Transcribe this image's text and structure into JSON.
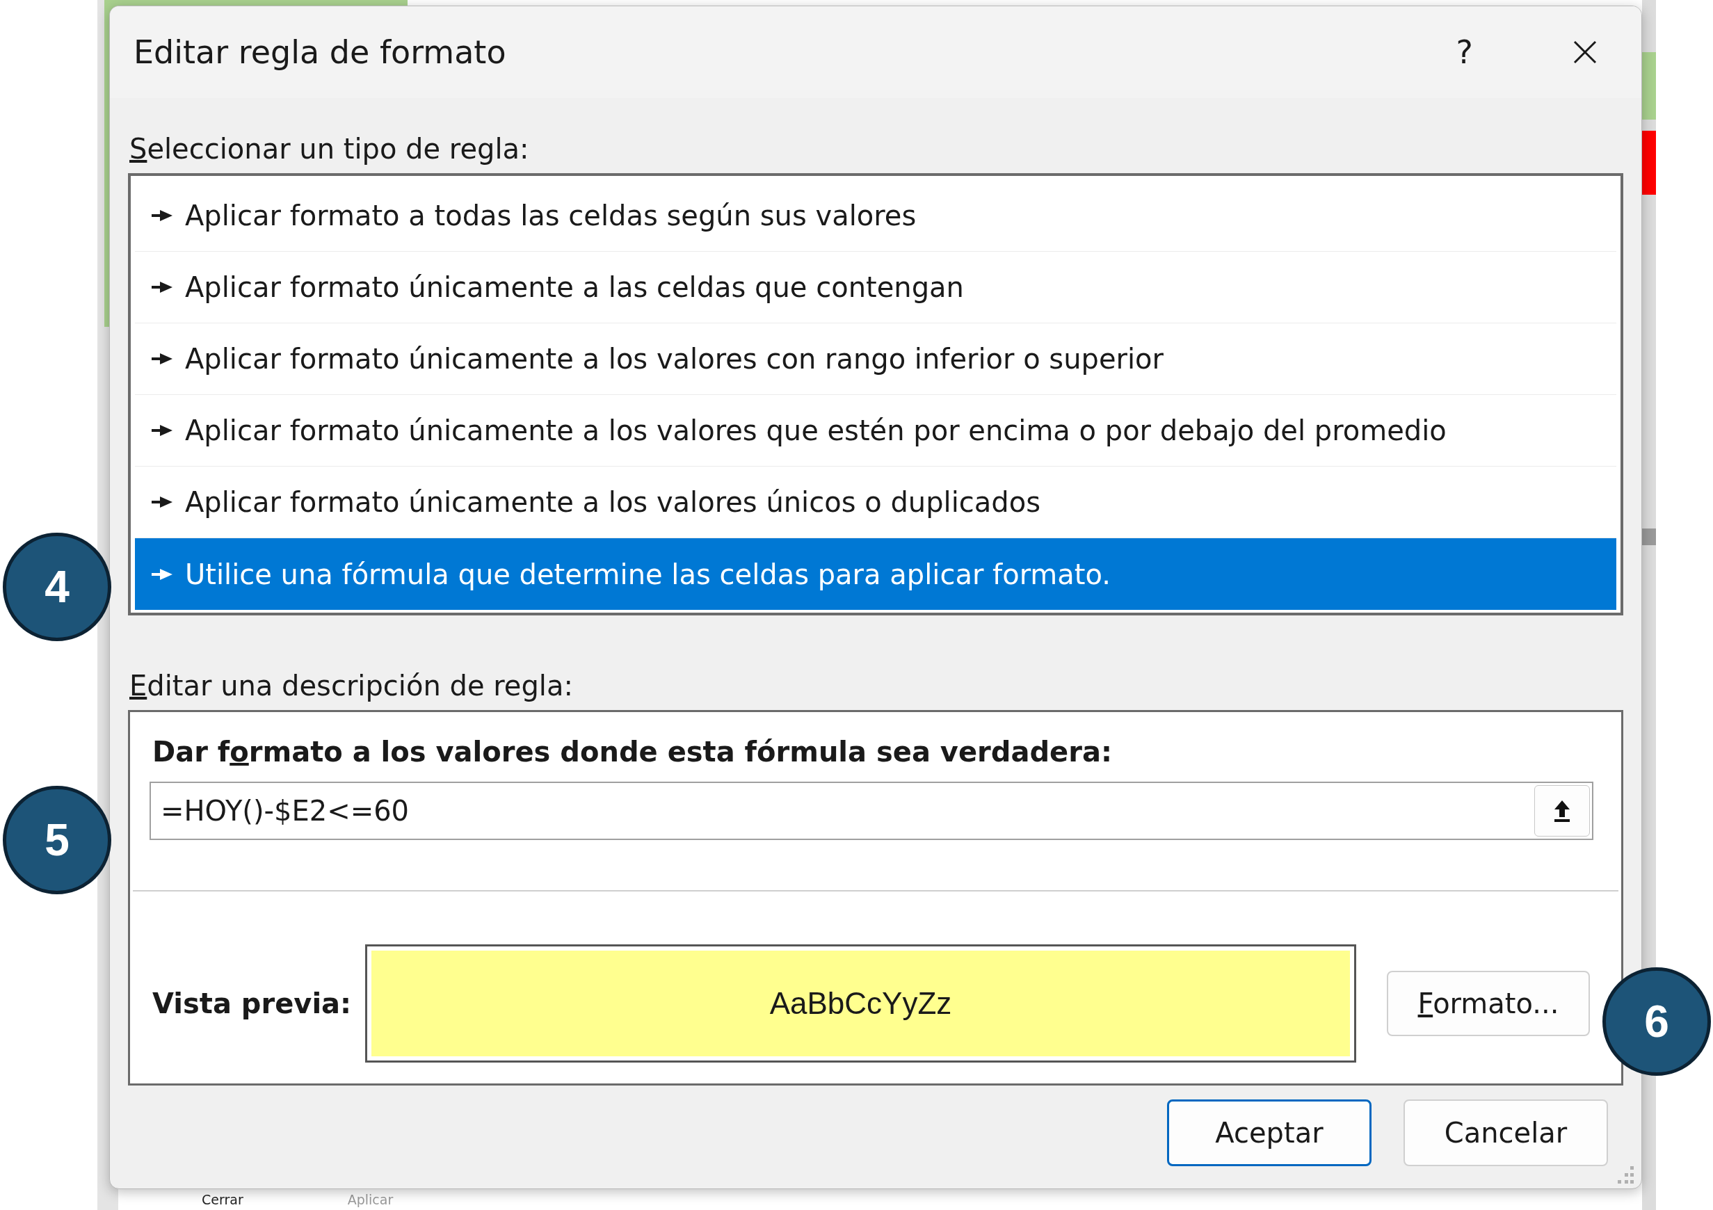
{
  "background_sheet": {
    "buttons": [
      {
        "label": "Cerrar",
        "disabled": false
      },
      {
        "label": "Aplicar",
        "disabled": true
      }
    ]
  },
  "dialog": {
    "title": "Editar regla de formato",
    "help": "?",
    "rule_type_label": {
      "access_key": "S",
      "after": "eleccionar un tipo de regla:"
    },
    "rule_types": [
      {
        "label": "Aplicar formato a todas las celdas según sus valores",
        "selected": false
      },
      {
        "label": "Aplicar formato únicamente a las celdas que contengan",
        "selected": false
      },
      {
        "label": "Aplicar formato únicamente a los valores con rango inferior o superior",
        "selected": false
      },
      {
        "label": "Aplicar formato únicamente a los valores que estén por encima o por debajo del promedio",
        "selected": false
      },
      {
        "label": "Aplicar formato únicamente a los valores únicos o duplicados",
        "selected": false
      },
      {
        "label": "Utilice una fórmula que determine las celdas para aplicar formato.",
        "selected": true
      }
    ],
    "description_label": {
      "access_key": "E",
      "after": "ditar una descripción de regla:"
    },
    "formula_heading": {
      "before": "Dar f",
      "access_key": "o",
      "after": "rmato a los valores donde esta fórmula sea verdadera:"
    },
    "formula_value": "=HOY()-$E2<=60",
    "preview_label": "Vista previa:",
    "preview_sample": "AaBbCcYyZz",
    "format_button": {
      "access_key": "F",
      "after": "ormato..."
    },
    "buttons": [
      {
        "label": "Aceptar",
        "default": true
      },
      {
        "label": "Cancelar",
        "default": false
      }
    ]
  },
  "callouts": [
    {
      "number": "4"
    },
    {
      "number": "5"
    },
    {
      "number": "6"
    }
  ]
}
